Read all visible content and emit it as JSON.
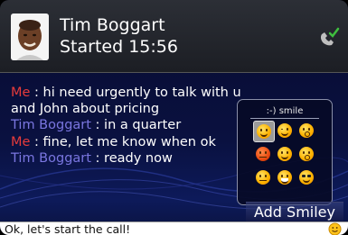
{
  "header": {
    "contact_name": "Tim Boggart",
    "status": "Started 15:56",
    "call_icon": "phone-check-icon",
    "avatar_icon": "contact-photo"
  },
  "messages": [
    {
      "sender": "Me",
      "sep": " : ",
      "text": "hi need urgently to talk with u",
      "kind": "me"
    },
    {
      "sender": "",
      "sep": "",
      "text": "and John about pricing",
      "kind": "cont"
    },
    {
      "sender": "Tim Boggart",
      "sep": " : ",
      "text": "in a quarter",
      "kind": "other"
    },
    {
      "sender": "Me",
      "sep": " : ",
      "text": "fine, let me know when ok",
      "kind": "me"
    },
    {
      "sender": "Tim Boggart",
      "sep": " : ",
      "text": "ready now",
      "kind": "other"
    }
  ],
  "smiley_picker": {
    "title": ":-) smile",
    "selected_index": 0,
    "smileys": [
      "smile-icon",
      "wink-icon",
      "surprised-icon",
      "angry-icon",
      "happy-icon",
      "shocked-icon",
      "tongue-icon",
      "grin-icon",
      "cool-icon"
    ]
  },
  "add_smiley_label": "Add Smiley",
  "input": {
    "value": "Ok, let's start the call!",
    "smiley_icon": "smiley-icon"
  },
  "colors": {
    "me_sender": "#e63b3b",
    "other_sender": "#7a76e0",
    "background": "#0a1140"
  }
}
